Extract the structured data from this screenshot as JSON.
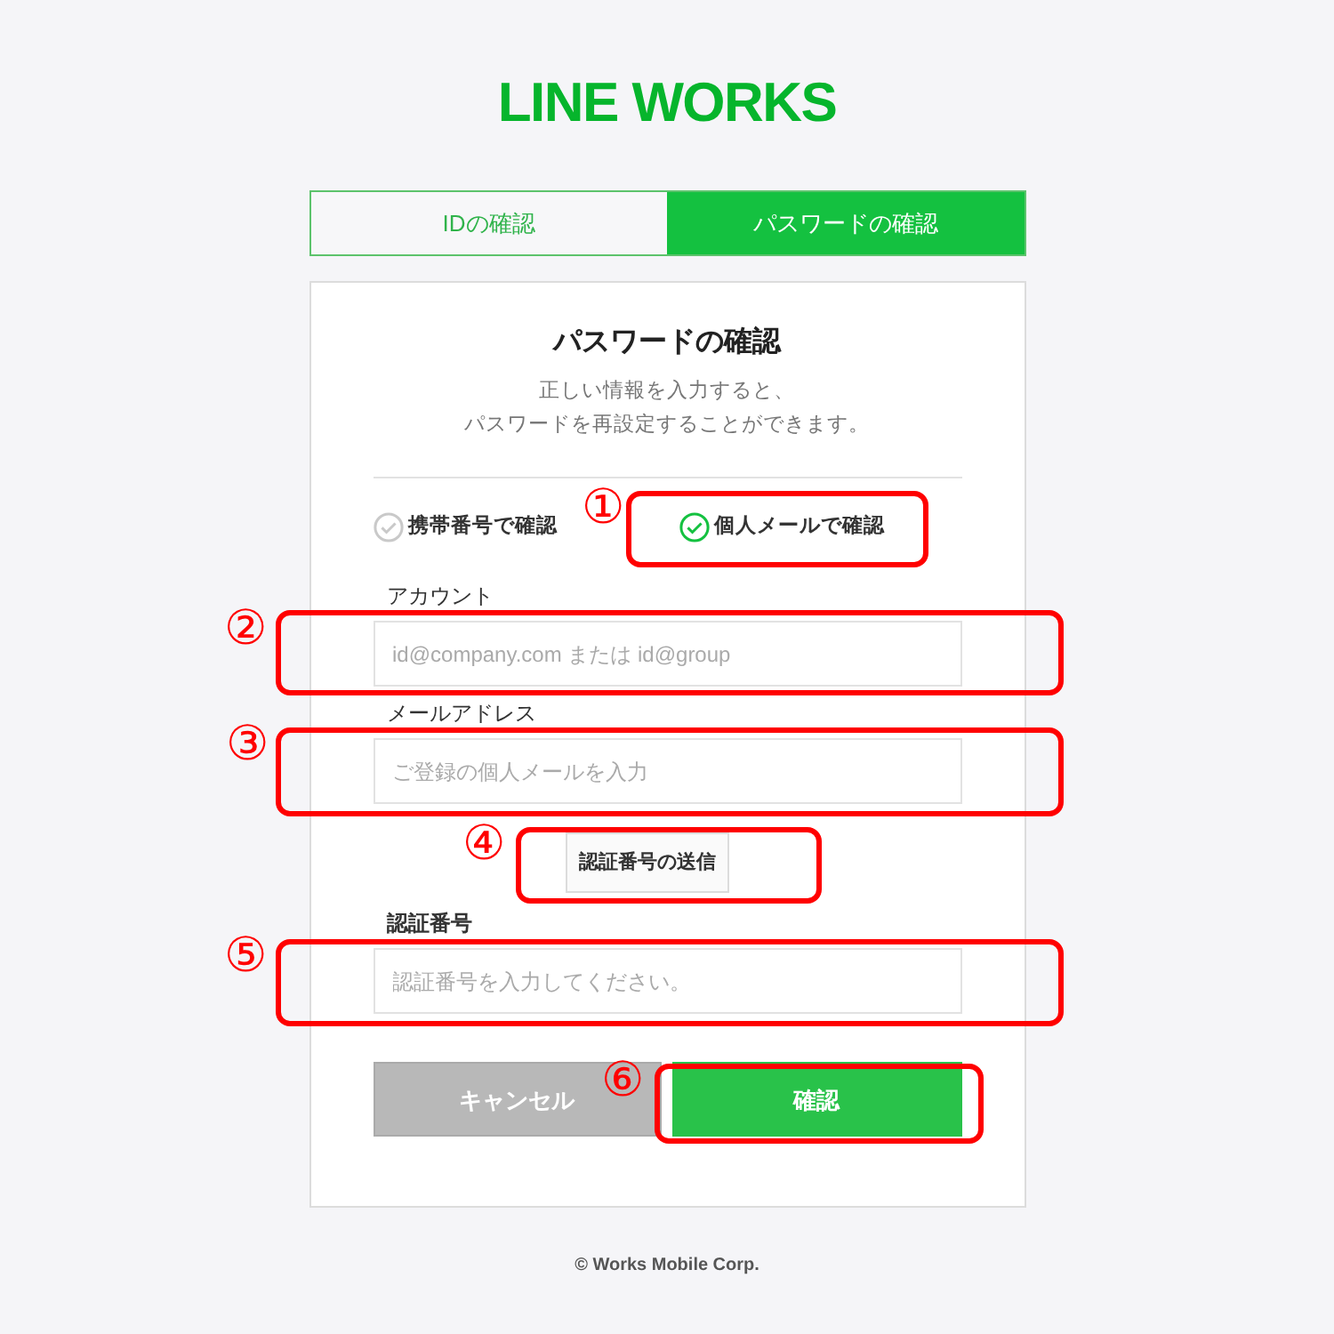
{
  "logo": "LINE WORKS",
  "tabs": [
    {
      "label": "IDの確認",
      "selected": false
    },
    {
      "label": "パスワードの確認",
      "selected": true
    }
  ],
  "card": {
    "title": "パスワードの確認",
    "description": [
      "正しい情報を入力すると、",
      "パスワードを再設定することができます。"
    ],
    "methods": [
      {
        "label": "携帯番号で確認",
        "selected": false
      },
      {
        "label": "個人メールで確認",
        "selected": true
      }
    ],
    "fields": [
      {
        "label": "アカウント",
        "placeholder": "id@company.com または id@group"
      },
      {
        "label": "メールアドレス",
        "placeholder": "ご登録の個人メールを入力"
      },
      {
        "label": "認証番号",
        "placeholder": "認証番号を入力してください。"
      }
    ],
    "send_button": "認証番号の送信",
    "cancel_button": {
      "label": "キャンセル",
      "disabled": true
    },
    "confirm_button": "確認"
  },
  "footer": "© Works Mobile Corp.",
  "annotations": [
    "①",
    "②",
    "③",
    "④",
    "⑤",
    "⑥"
  ]
}
